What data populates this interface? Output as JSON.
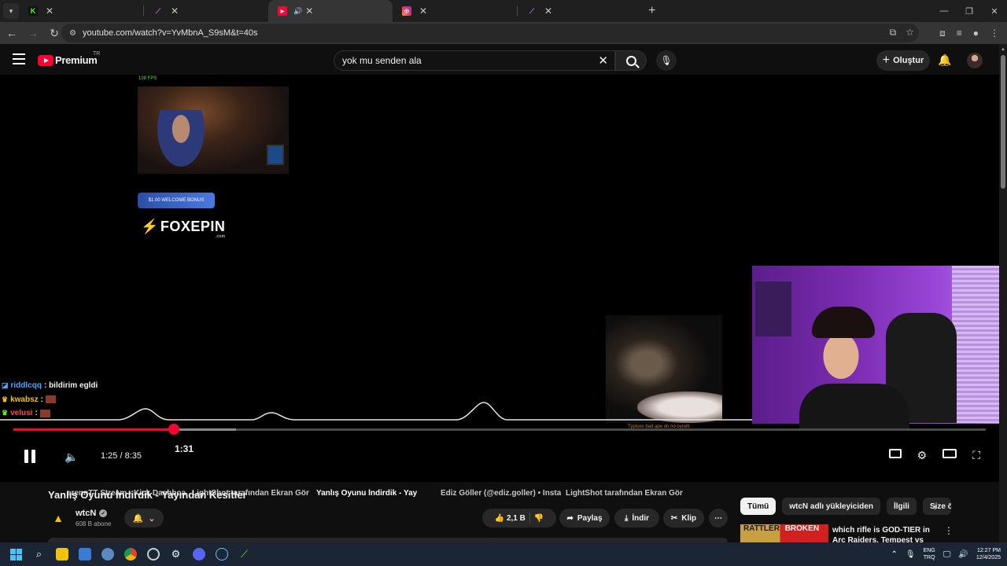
{
  "browser": {
    "tabs": [
      {
        "title": "erennTT Stream - Kick Dashboa",
        "favicon": "kick-icon",
        "active": false
      },
      {
        "title": "LightShot tarafından Ekran Gör",
        "favicon": "lightshot-icon",
        "active": false
      },
      {
        "title": "Yanlış Oyunu İndirdik - Yay",
        "favicon": "youtube-icon",
        "active": true
      },
      {
        "title": "Ediz Göller (@ediz.goller) • Insta",
        "favicon": "instagram-icon",
        "active": false
      },
      {
        "title": "LightShot tarafından Ekran Gör",
        "favicon": "lightshot-icon",
        "active": false
      }
    ],
    "url": "youtube.com/watch?v=YvMbnA_S9sM&t=40s",
    "accent": "#ff0033"
  },
  "youtube": {
    "logo_text": "Premium",
    "region": "TR",
    "search_value": "yok mu senden ala",
    "create_label": "Oluştur"
  },
  "player": {
    "fps_label": "138 FPS",
    "ad_badge": "$1.00 WELCOME BONUS",
    "sponsor": "FOXEPIN",
    "sponsor_domain": ".com",
    "overlay_text": "Typtoxx bad ape oh no oyrutti",
    "chat": [
      {
        "user": "riddlcqq",
        "message": ": bildirim egldi",
        "color": "#4da6ff"
      },
      {
        "user": "kwabsz",
        "message": ":",
        "color": "#f2c400"
      },
      {
        "user": "velusi",
        "message": ":",
        "color": "#ff4d4d"
      }
    ],
    "current_time": "1:25",
    "duration": "8:35",
    "hover_time": "1:31",
    "progress_fraction": 0.165,
    "buffered_fraction": 0.229
  },
  "video": {
    "title": "Yanlış Oyunu İndirdik - Yayından Kesitler",
    "channel": "wtcN",
    "subscribers": "608 B abone",
    "likes": "2,1 B",
    "share_label": "Paylaş",
    "download_label": "İndir",
    "clip_label": "Klip"
  },
  "sidebar": {
    "chips": [
      "Tümü",
      "wtcN adlı yükleyiciden",
      "İlgili",
      "Size ö"
    ],
    "rec_thumb_text": "RATTLER",
    "rec_thumb_badge": "BROKEN",
    "rec_title": "which rifle is GOD-TIER in Arc Raiders. Tempest vs Rattler"
  },
  "taskbar": {
    "lang_top": "ENG",
    "lang_bottom": "TRQ",
    "time": "12:27 PM",
    "date": "12/4/2025"
  }
}
